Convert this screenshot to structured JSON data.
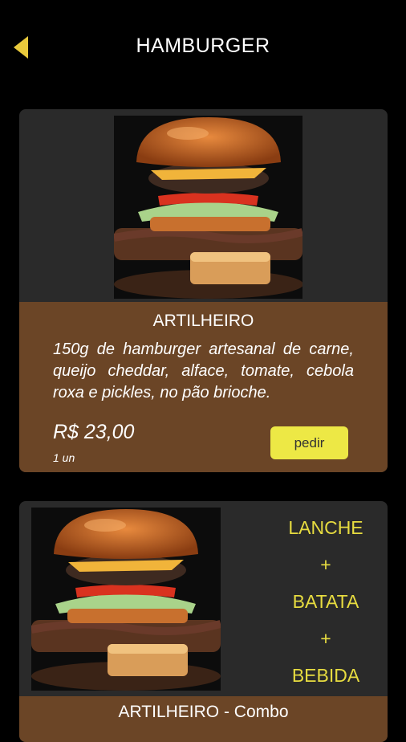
{
  "header": {
    "title": "HAMBURGER",
    "back_icon": "back-arrow-icon",
    "accent": "#e8c93c"
  },
  "products": [
    {
      "name": "ARTILHEIRO",
      "description": "150g de hamburger artesanal de carne, queijo cheddar, alface, tomate, cebola roxa e pickles, no pão brioche.",
      "price": "R$ 23,00",
      "unit": "1 un",
      "order_label": "pedir"
    },
    {
      "name": "ARTILHEIRO - Combo",
      "combo_lines": [
        "LANCHE",
        "+",
        "BATATA",
        "+",
        "BEBIDA"
      ]
    }
  ],
  "colors": {
    "card_bg": "#2a2a2a",
    "info_bg": "#6b4526",
    "button": "#ede845",
    "combo_text": "#e7dc40"
  }
}
